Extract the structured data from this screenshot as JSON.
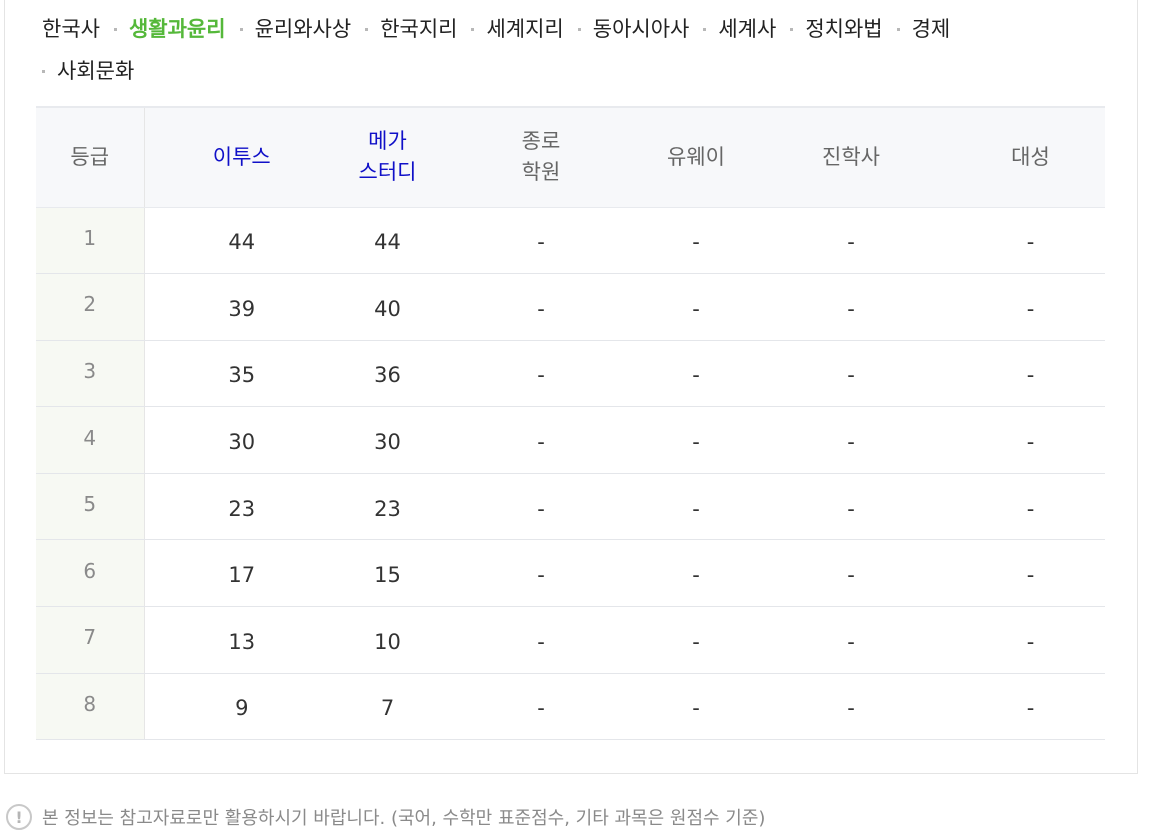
{
  "tabs": [
    {
      "label": "한국사",
      "active": false
    },
    {
      "label": "생활과윤리",
      "active": true
    },
    {
      "label": "윤리와사상",
      "active": false
    },
    {
      "label": "한국지리",
      "active": false
    },
    {
      "label": "세계지리",
      "active": false
    },
    {
      "label": "동아시아사",
      "active": false
    },
    {
      "label": "세계사",
      "active": false
    },
    {
      "label": "정치와법",
      "active": false
    },
    {
      "label": "경제",
      "active": false
    },
    {
      "label": "사회문화",
      "active": false
    }
  ],
  "table": {
    "headers": {
      "grade": "등급",
      "etoos": "이투스",
      "mega_line1": "메가",
      "mega_line2": "스터디",
      "jongro_line1": "종로",
      "jongro_line2": "학원",
      "uway": "유웨이",
      "jinhak": "진학사",
      "daesung": "대성"
    },
    "rows": [
      {
        "grade": "1",
        "etoos": "44",
        "mega": "44",
        "jongro": "-",
        "uway": "-",
        "jinhak": "-",
        "daesung": "-"
      },
      {
        "grade": "2",
        "etoos": "39",
        "mega": "40",
        "jongro": "-",
        "uway": "-",
        "jinhak": "-",
        "daesung": "-"
      },
      {
        "grade": "3",
        "etoos": "35",
        "mega": "36",
        "jongro": "-",
        "uway": "-",
        "jinhak": "-",
        "daesung": "-"
      },
      {
        "grade": "4",
        "etoos": "30",
        "mega": "30",
        "jongro": "-",
        "uway": "-",
        "jinhak": "-",
        "daesung": "-"
      },
      {
        "grade": "5",
        "etoos": "23",
        "mega": "23",
        "jongro": "-",
        "uway": "-",
        "jinhak": "-",
        "daesung": "-"
      },
      {
        "grade": "6",
        "etoos": "17",
        "mega": "15",
        "jongro": "-",
        "uway": "-",
        "jinhak": "-",
        "daesung": "-"
      },
      {
        "grade": "7",
        "etoos": "13",
        "mega": "10",
        "jongro": "-",
        "uway": "-",
        "jinhak": "-",
        "daesung": "-"
      },
      {
        "grade": "8",
        "etoos": "9",
        "mega": "7",
        "jongro": "-",
        "uway": "-",
        "jinhak": "-",
        "daesung": "-"
      }
    ]
  },
  "notice": {
    "icon": "exclamation-circle-icon",
    "symbol": "!",
    "text": "본 정보는 참고자료로만 활용하시기 바랍니다. (국어, 수학만 표준점수, 기타 과목은 원점수 기준)"
  },
  "colors": {
    "active_tab": "#55b83a",
    "highlight_header": "#1010c8",
    "grade_column_bg": "#f7f9f3",
    "header_bg": "#f7f8fa"
  }
}
